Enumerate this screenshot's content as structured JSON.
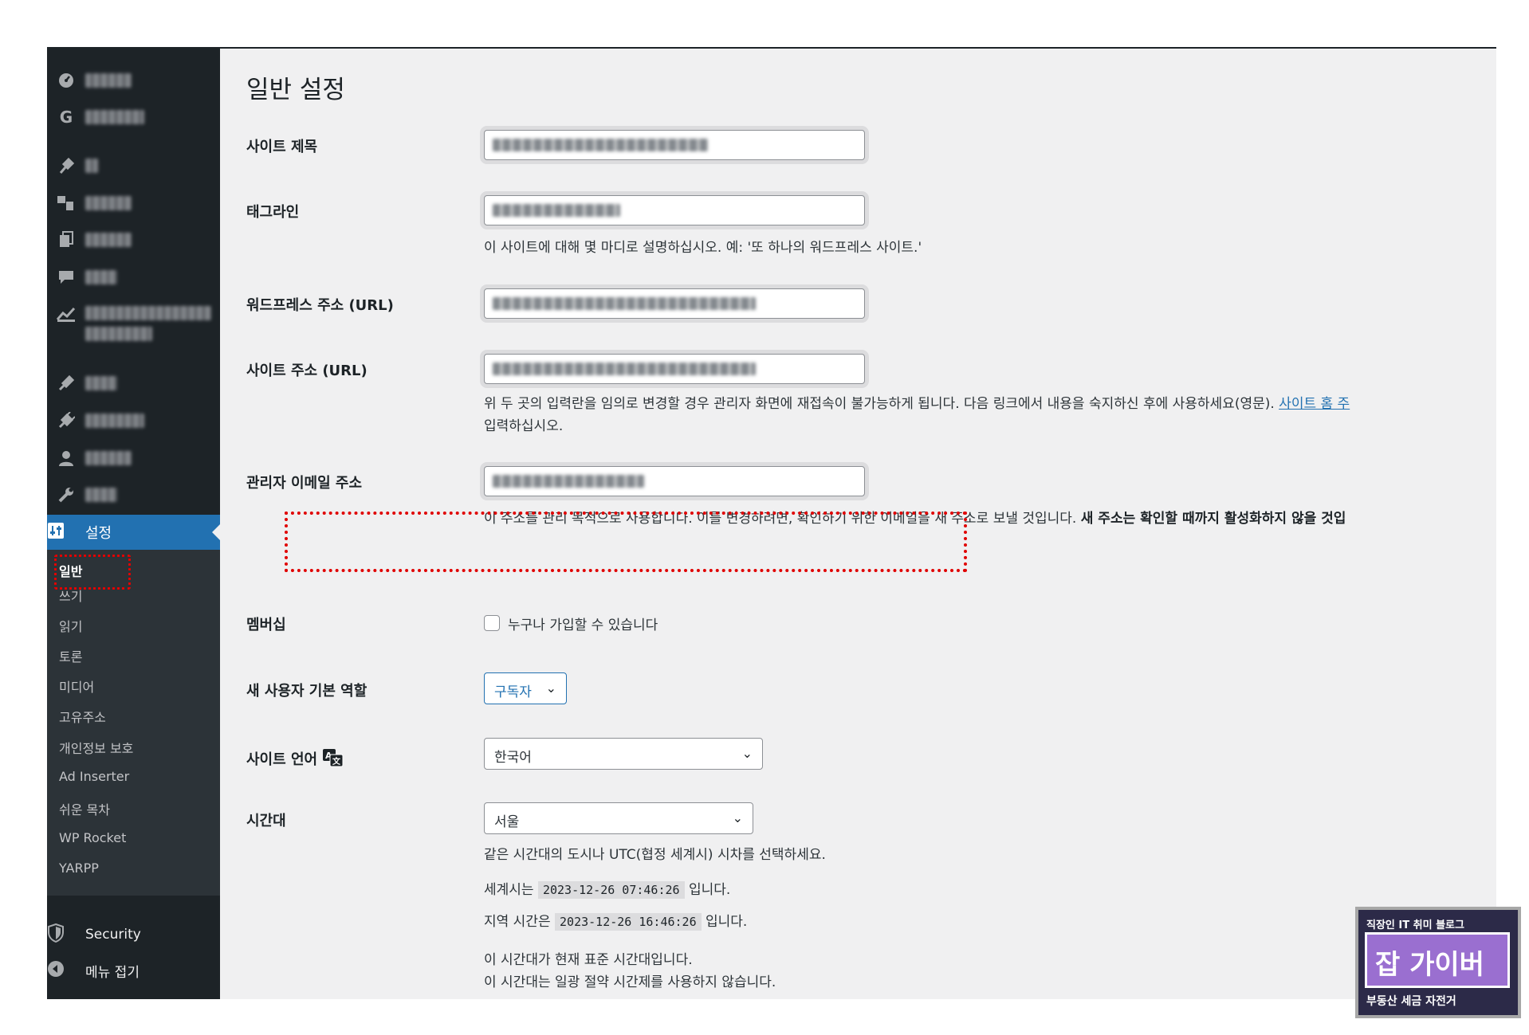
{
  "sidebar": {
    "settings_label": "설정",
    "submenu": [
      "일반",
      "쓰기",
      "읽기",
      "토론",
      "미디어",
      "고유주소",
      "개인정보 보호",
      "Ad Inserter",
      "쉬운 목차",
      "WP Rocket",
      "YARPP"
    ],
    "security_label": "Security",
    "collapse_label": "메뉴 접기"
  },
  "page": {
    "title": "일반 설정"
  },
  "form": {
    "site_title_label": "사이트 제목",
    "tagline_label": "태그라인",
    "tagline_desc": "이 사이트에 대해 몇 마디로 설명하십시오. 예: '또 하나의 워드프레스 사이트.'",
    "wp_url_label": "워드프레스 주소 (URL)",
    "site_url_label": "사이트 주소 (URL)",
    "url_desc_line1": "위 두 곳의 입력란을 임의로 변경할 경우 관리자 화면에 재접속이 불가능하게 됩니다. 다음 링크에서 내용을 숙지하신 후에 사용하세요(영문).",
    "url_desc_link": "사이트 홈 주",
    "url_desc_line2": "입력하십시오.",
    "admin_email_label": "관리자 이메일 주소",
    "admin_email_desc": "이 주소를 관리 목적으로 사용합니다. 이를 변경하려면, 확인하기 위한 이메일을 새 주소로 보낼 것입니다.",
    "admin_email_desc_bold": "새 주소는 확인할 때까지 활성화하지 않을 것입",
    "membership_label": "멤버십",
    "membership_checkbox": "누구나 가입할 수 있습니다",
    "default_role_label": "새 사용자 기본 역할",
    "default_role_value": "구독자",
    "site_language_label": "사이트 언어",
    "site_language_value": "한국어",
    "timezone_label": "시간대",
    "timezone_value": "서울",
    "timezone_desc": "같은 시간대의 도시나 UTC(협정 세계시) 시차를 선택하세요.",
    "utc_prefix": "세계시는",
    "utc_time": "2023-12-26 07:46:26",
    "utc_suffix": "입니다.",
    "local_prefix": "지역 시간은",
    "local_time": "2023-12-26 16:46:26",
    "local_suffix": "입니다.",
    "standard_time_note": "이 시간대가 현재 표준 시간대입니다.",
    "dst_note": "이 시간대는 일광 절약 시간제를 사용하지 않습니다."
  },
  "watermark": {
    "top": "직장인 IT 취미 블로그",
    "main": "잡 가이버",
    "bottom": "부동산 세금 자전거"
  },
  "colors": {
    "sidebar_bg": "#1d2327",
    "accent": "#2271b1",
    "highlight": "#e00000"
  }
}
